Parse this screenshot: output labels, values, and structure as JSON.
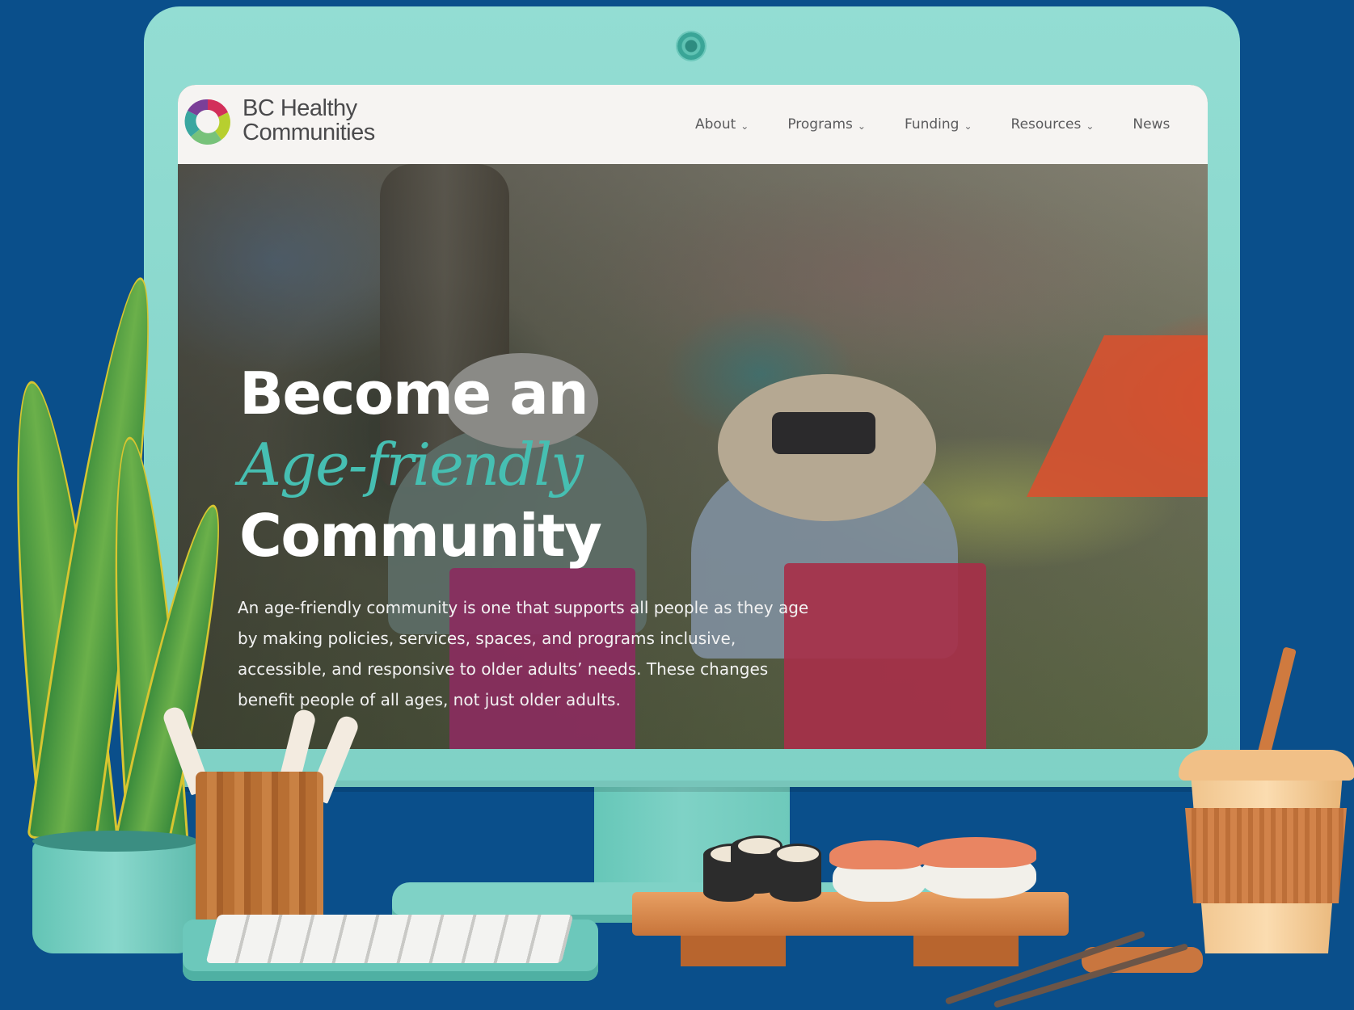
{
  "site": {
    "logo": {
      "line1": "BC Healthy",
      "line2": "Communities"
    },
    "nav": [
      {
        "label": "About",
        "has_dropdown": true
      },
      {
        "label": "Programs",
        "has_dropdown": true
      },
      {
        "label": "Funding",
        "has_dropdown": true
      },
      {
        "label": "Resources",
        "has_dropdown": true
      },
      {
        "label": "News",
        "has_dropdown": false
      }
    ],
    "dropdown_glyph": "⌄"
  },
  "hero": {
    "title_line1": "Become an",
    "title_accent": "Age-friendly",
    "title_line3": "Community",
    "description": "An age-friendly community is one that supports all people as they age by making policies, services, spaces, and programs inclusive, accessible, and responsive to older adults’ needs. These changes benefit people of all ages, not just older adults."
  },
  "colors": {
    "background": "#0a4f8b",
    "monitor": "#7fd2c6",
    "accent_teal": "#46bfb2",
    "nav_bg": "#f6f4f2"
  },
  "icons": {
    "logo_mark": "bc-healthy-communities-logo-icon",
    "dropdown": "chevron-down-icon",
    "camera": "webcam-icon"
  }
}
